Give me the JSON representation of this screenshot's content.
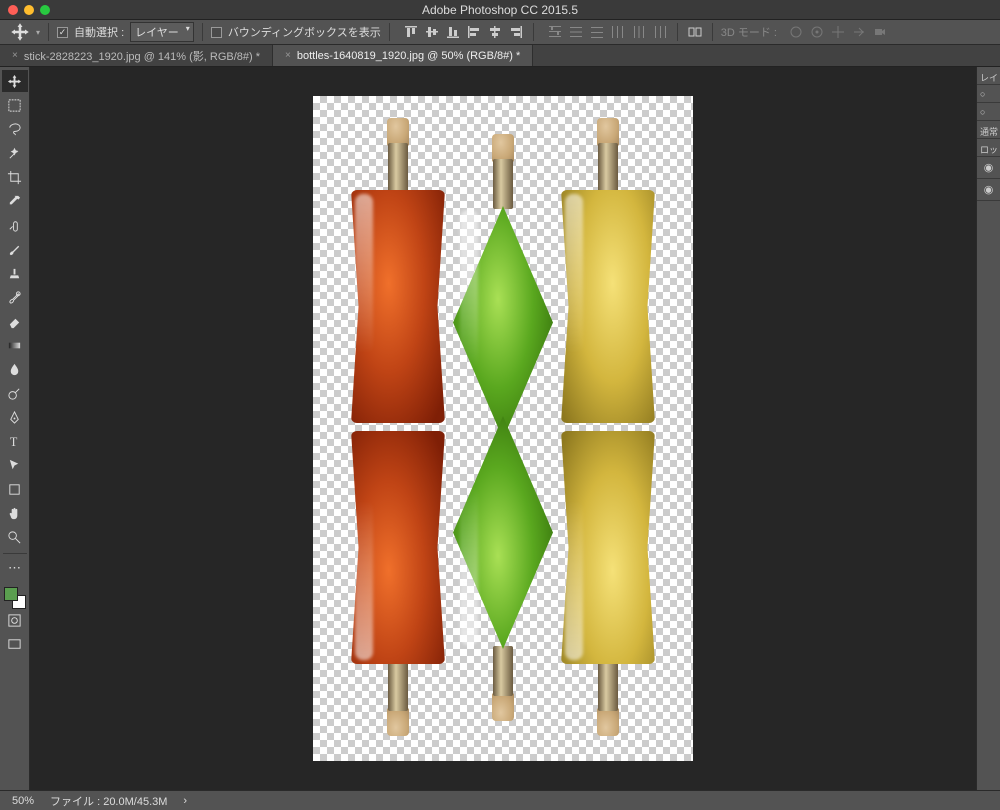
{
  "app": {
    "title": "Adobe Photoshop CC 2015.5"
  },
  "optionsbar": {
    "auto_select_label": "自動選択 :",
    "auto_select_checked": true,
    "layer_dropdown": "レイヤー",
    "show_bbox_label": "バウンディングボックスを表示",
    "show_bbox_checked": false,
    "mode3d_label": "3D モード :"
  },
  "tabs": [
    {
      "label": "stick-2828223_1920.jpg @ 141% (影, RGB/8#) *",
      "active": false
    },
    {
      "label": "bottles-1640819_1920.jpg @ 50% (RGB/8#) *",
      "active": true
    }
  ],
  "tools": [
    "move",
    "marquee",
    "lasso",
    "magicwand",
    "crop",
    "eyedropper",
    "healing",
    "brush",
    "clone",
    "history",
    "eraser",
    "gradient",
    "blur",
    "dodge",
    "pen",
    "text",
    "path",
    "shape",
    "hand",
    "zoom"
  ],
  "colors": {
    "fg": "#5a9e4f",
    "bg": "#ffffff"
  },
  "canvas": {
    "bottles": [
      {
        "color": "red"
      },
      {
        "color": "green"
      },
      {
        "color": "gold"
      }
    ]
  },
  "right_panel": {
    "labels": [
      "レイ",
      "○",
      "○",
      "通常",
      "ロッ"
    ],
    "eyes": [
      "◉",
      "◉"
    ]
  },
  "statusbar": {
    "zoom": "50%",
    "fileinfo": "ファイル : 20.0M/45.3M",
    "arrow": "›"
  }
}
